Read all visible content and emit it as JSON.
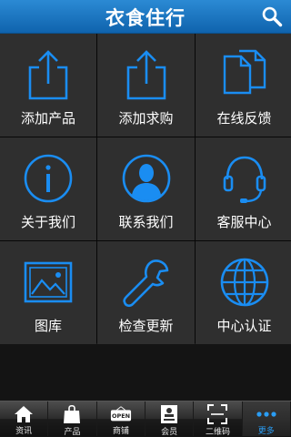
{
  "header": {
    "title": "衣食住行"
  },
  "tiles": [
    {
      "label": "添加产品",
      "icon": "share-upload-icon"
    },
    {
      "label": "添加求购",
      "icon": "share-upload-icon"
    },
    {
      "label": "在线反馈",
      "icon": "documents-icon"
    },
    {
      "label": "关于我们",
      "icon": "info-icon"
    },
    {
      "label": "联系我们",
      "icon": "person-icon"
    },
    {
      "label": "客服中心",
      "icon": "headset-icon"
    },
    {
      "label": "图库",
      "icon": "picture-icon"
    },
    {
      "label": "检查更新",
      "icon": "wrench-icon"
    },
    {
      "label": "中心认证",
      "icon": "globe-icon"
    }
  ],
  "tabs": [
    {
      "label": "资讯",
      "icon": "home-icon"
    },
    {
      "label": "产品",
      "icon": "shopping-bag-icon"
    },
    {
      "label": "商铺",
      "icon": "open-sign-icon",
      "sign_text": "OPEN"
    },
    {
      "label": "会员",
      "icon": "member-card-icon"
    },
    {
      "label": "二维码",
      "icon": "qr-scan-icon"
    },
    {
      "label": "更多",
      "icon": "more-dots-icon"
    }
  ],
  "colors": {
    "accent": "#1a8df2",
    "header": "#1a74c2",
    "tile": "#2f2f2f"
  }
}
